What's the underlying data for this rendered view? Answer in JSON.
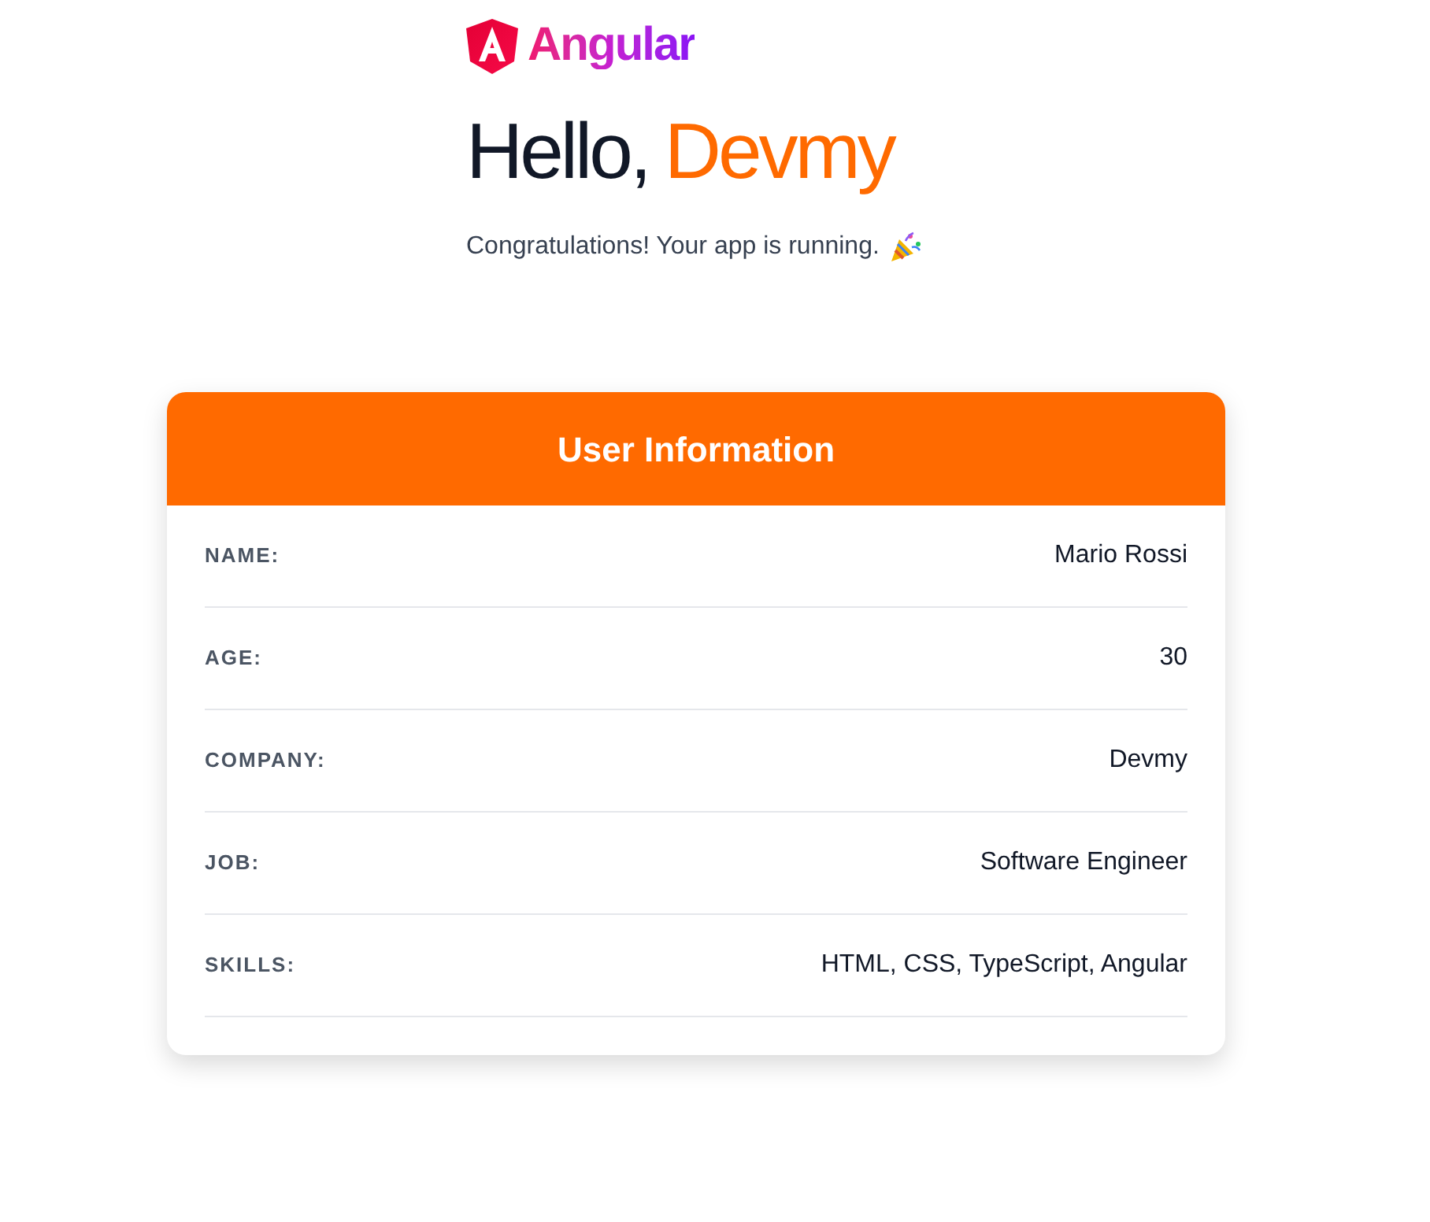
{
  "logo": {
    "text": "Angular"
  },
  "heading": {
    "greeting": "Hello,",
    "name": "Devmy"
  },
  "message": "Congratulations! Your app is running.",
  "card": {
    "title": "User Information",
    "rows": [
      {
        "label": "NAME:",
        "value": "Mario Rossi"
      },
      {
        "label": "AGE:",
        "value": "30"
      },
      {
        "label": "COMPANY:",
        "value": "Devmy"
      },
      {
        "label": "JOB:",
        "value": "Software Engineer"
      },
      {
        "label": "SKILLS:",
        "value": "HTML, CSS, TypeScript, Angular"
      }
    ]
  }
}
